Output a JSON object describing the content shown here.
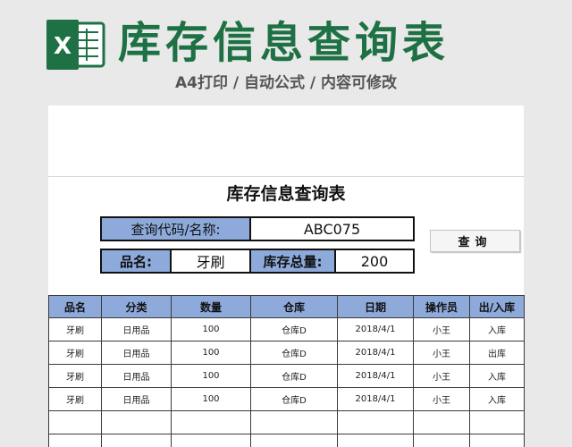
{
  "banner": {
    "title": "库存信息查询表",
    "subtitle": "A4打印 / 自动公式 / 内容可修改",
    "logo_letter": "X"
  },
  "report": {
    "title": "库存信息查询表",
    "query_code_label": "查询代码/名称:",
    "query_code_value": "ABC075",
    "name_label": "品名:",
    "name_value": "牙刷",
    "total_label": "库存总量:",
    "total_value": "200",
    "query_button_label": "查询"
  },
  "table": {
    "headers": [
      "品名",
      "分类",
      "数量",
      "仓库",
      "日期",
      "操作员",
      "出/入库"
    ],
    "rows": [
      [
        "牙刷",
        "日用品",
        "100",
        "仓库D",
        "2018/4/1",
        "小王",
        "入库"
      ],
      [
        "牙刷",
        "日用品",
        "100",
        "仓库D",
        "2018/4/1",
        "小王",
        "出库"
      ],
      [
        "牙刷",
        "日用品",
        "100",
        "仓库D",
        "2018/4/1",
        "小王",
        "入库"
      ],
      [
        "牙刷",
        "日用品",
        "100",
        "仓库D",
        "2018/4/1",
        "小王",
        "入库"
      ],
      [
        "",
        "",
        "",
        "",
        "",
        "",
        ""
      ],
      [
        "",
        "",
        "",
        "",
        "",
        "",
        ""
      ]
    ]
  },
  "colors": {
    "brand_green": "#1e7145",
    "header_blue": "#8eaadb"
  }
}
